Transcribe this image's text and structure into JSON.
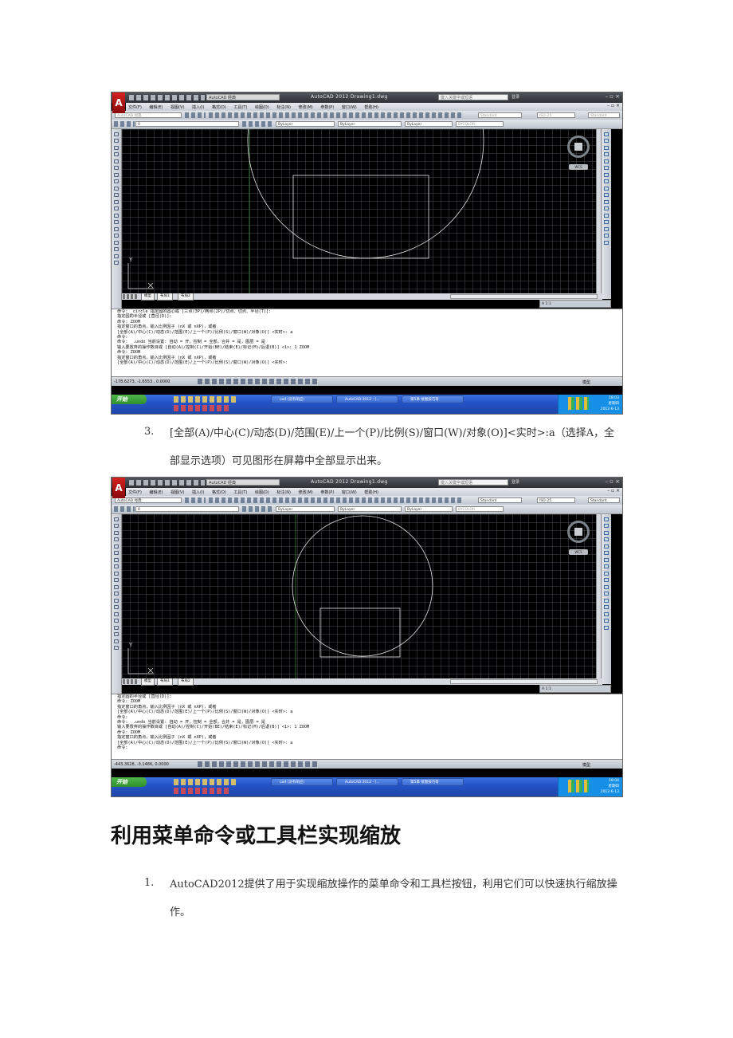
{
  "autocad": {
    "app_title": "AutoCAD 2012     Drawing1.dwg",
    "workspace": "AutoCAD 经典",
    "search_placeholder": "键入关键字或短语",
    "login": "登录",
    "menus": [
      "文件(F)",
      "编辑(E)",
      "视图(V)",
      "插入(I)",
      "格式(O)",
      "工具(T)",
      "绘图(D)",
      "标注(N)",
      "修改(M)",
      "参数(P)",
      "窗口(W)",
      "帮助(H)"
    ],
    "layer": "0",
    "bylayer": "ByLayer",
    "bycolor": "BYCOLOR",
    "text_style": "Standard",
    "dim_style": "ISO-25",
    "table_style": "Standard",
    "wcs": "WCS",
    "ucs_y": "Y",
    "tabs": [
      "模型",
      "布局1",
      "布局2"
    ],
    "anno_scale": "A 1:1",
    "status_model": "模型",
    "start": "开始",
    "tasks": [
      "cad (没有响应)",
      "AutoCAD 2012 - [...",
      "第5章 绘图技巧等"
    ],
    "weekday": "星期四",
    "date": "2012-6-13"
  },
  "shot1": {
    "coords": "-178.6273, -1.6553 , 0.0000",
    "time": "18:03",
    "command_lines": [
      "命令: _circle 指定圆的圆心或 [三点(3P)/两点(2P)/切点、切点、半径(T)]:",
      "指定圆的半径或 [直径(D)]:",
      "命令: ZOOM",
      "指定窗口的角点，输入比例因子 (nX 或 nXP)，或者",
      "[全部(A)/中心(C)/动态(D)/范围(E)/上一个(P)/比例(S)/窗口(W)/对象(O)] <实时>: a",
      "命令:",
      "命令: _.undo 当前设置: 自动 = 开，控制 = 全部，合并 = 是，图层 = 是",
      "输入要放弃的操作数目或 [自动(A)/控制(C)/开始(BE)/结束(E)/标记(M)/后退(B)] <1>: 1 ZOOM",
      "命令: ZOOM",
      "指定窗口的角点，输入比例因子 (nX 或 nXP)，或者",
      "[全部(A)/中心(C)/动态(D)/范围(E)/上一个(P)/比例(S)/窗口(W)/对象(O)] <实时>:"
    ]
  },
  "shot2": {
    "coords": "-443.3628, -3.1486, 0.0000",
    "time": "18:04",
    "command_lines": [
      "指定圆的半径或 [直径(D)]:",
      "命令: ZOOM",
      "指定窗口的角点，输入比例因子 (nX 或 nXP)，或者",
      "[全部(A)/中心(C)/动态(D)/范围(E)/上一个(P)/比例(S)/窗口(W)/对象(O)] <实时>: a",
      "命令:",
      "命令: _.undo 当前设置: 自动 = 开，控制 = 全部，合并 = 是，图层 = 是",
      "输入要放弃的操作数目或 [自动(A)/控制(C)/开始(BE)/结束(E)/标记(M)/后退(B)] <1>: 1 ZOOM",
      "命令: ZOOM",
      "指定窗口的角点，输入比例因子 (nX 或 nXP)，或者",
      "[全部(A)/中心(C)/动态(D)/范围(E)/上一个(P)/比例(S)/窗口(W)/对象(O)] <实时>: a",
      "命令:"
    ]
  },
  "doc": {
    "step3_num": "3.",
    "step3_text": "[全部(A)/中心(C)/动态(D)/范围(E)/上一个(P)/比例(S)/窗口(W)/对象(O)]<实时>:a（选择A，全部显示选项）可见图形在屏幕中全部显示出来。",
    "heading": "利用菜单命令或工具栏实现缩放",
    "step1_num": "1.",
    "step1_text": "AutoCAD2012提供了用于实现缩放操作的菜单命令和工具栏按钮，利用它们可以快速执行缩放操作。"
  }
}
